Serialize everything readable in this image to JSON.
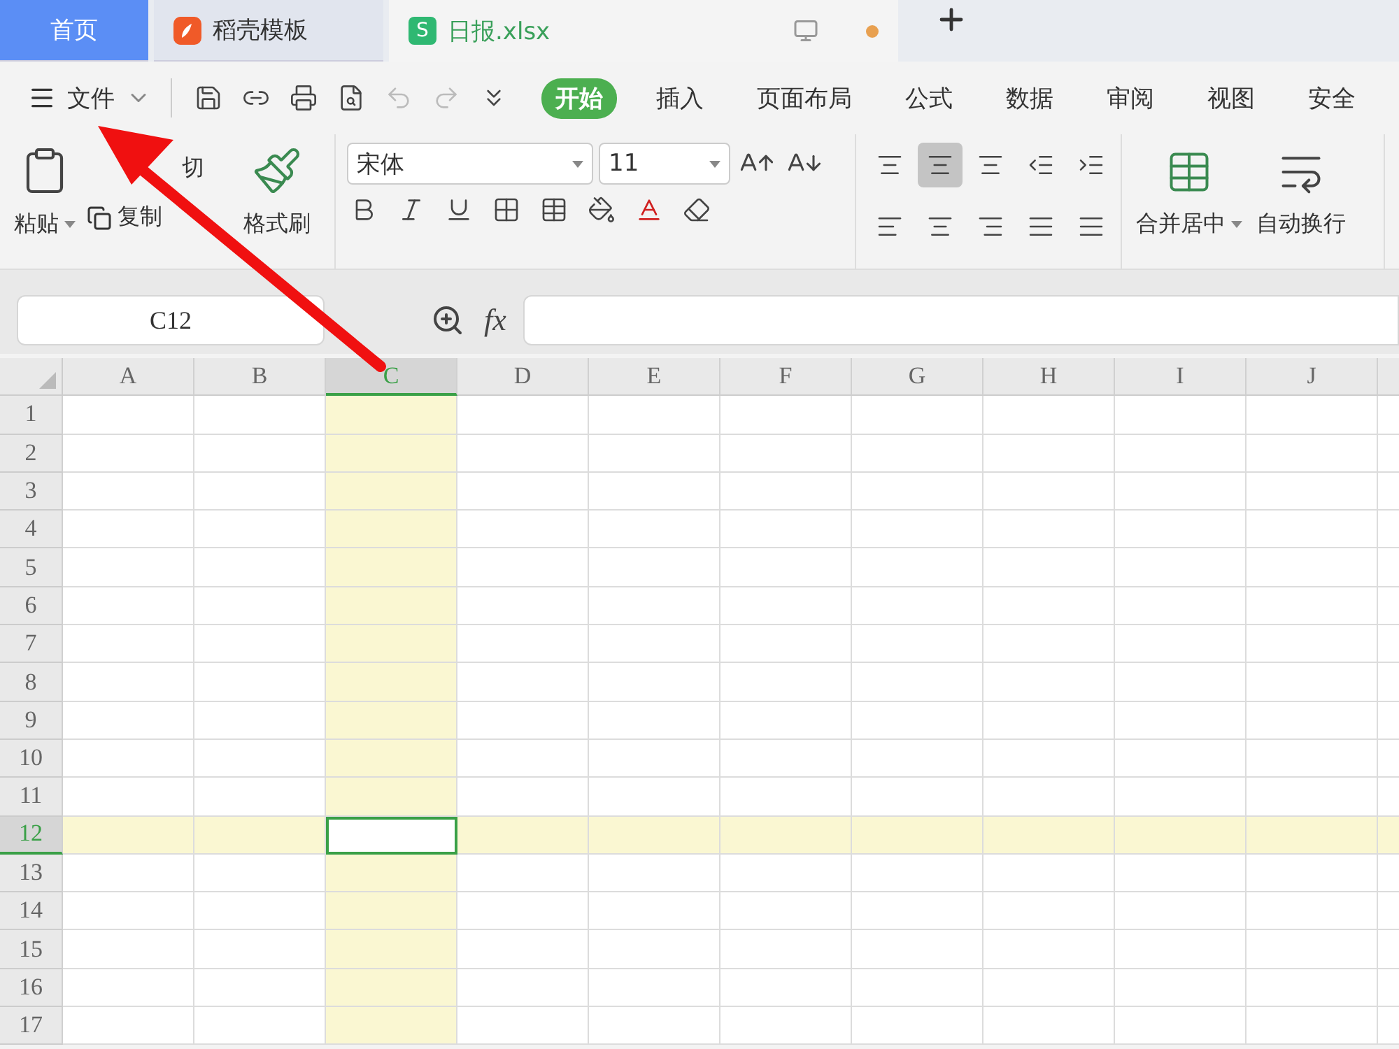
{
  "tabs": [
    {
      "label": "首页",
      "kind": "home",
      "selected": false
    },
    {
      "label": "稻壳模板",
      "kind": "template",
      "selected": false
    },
    {
      "label": "日报.xlsx",
      "kind": "sheet",
      "icon_text": "S",
      "selected": true
    }
  ],
  "file_menu": {
    "label": "文件"
  },
  "ribbon_tabs": [
    {
      "label": "开始",
      "selected": true
    },
    {
      "label": "插入",
      "selected": false
    },
    {
      "label": "页面布局",
      "selected": false
    },
    {
      "label": "公式",
      "selected": false
    },
    {
      "label": "数据",
      "selected": false
    },
    {
      "label": "审阅",
      "selected": false
    },
    {
      "label": "视图",
      "selected": false
    },
    {
      "label": "安全",
      "selected": false
    }
  ],
  "clipboard": {
    "paste": "粘贴",
    "cut": "切",
    "copy": "复制",
    "format_painter": "格式刷"
  },
  "font": {
    "name": "宋体",
    "size": "11"
  },
  "align_tools": [
    {
      "kind": "top",
      "selected": false
    },
    {
      "kind": "middle",
      "selected": true
    },
    {
      "kind": "bottom",
      "selected": false
    },
    {
      "kind": "outdent",
      "selected": false
    },
    {
      "kind": "indent",
      "selected": false
    },
    {
      "kind": "left",
      "selected": false
    },
    {
      "kind": "center",
      "selected": false
    },
    {
      "kind": "right",
      "selected": false
    },
    {
      "kind": "justify",
      "selected": false
    },
    {
      "kind": "distributed",
      "selected": false
    }
  ],
  "merge": {
    "label": "合并居中"
  },
  "wrap": {
    "label": "自动换行"
  },
  "formula_bar": {
    "name_box": "C12",
    "fx": "fx"
  },
  "grid": {
    "columns": [
      {
        "label": "A",
        "selected": false
      },
      {
        "label": "B",
        "selected": false
      },
      {
        "label": "C",
        "selected": true
      },
      {
        "label": "D",
        "selected": false
      },
      {
        "label": "E",
        "selected": false
      },
      {
        "label": "F",
        "selected": false
      },
      {
        "label": "G",
        "selected": false
      },
      {
        "label": "H",
        "selected": false
      },
      {
        "label": "I",
        "selected": false
      },
      {
        "label": "J",
        "selected": false
      }
    ],
    "rows": [
      {
        "label": "1",
        "selected": false
      },
      {
        "label": "2",
        "selected": false
      },
      {
        "label": "3",
        "selected": false
      },
      {
        "label": "4",
        "selected": false
      },
      {
        "label": "5",
        "selected": false
      },
      {
        "label": "6",
        "selected": false
      },
      {
        "label": "7",
        "selected": false
      },
      {
        "label": "8",
        "selected": false
      },
      {
        "label": "9",
        "selected": false
      },
      {
        "label": "10",
        "selected": false
      },
      {
        "label": "11",
        "selected": false
      },
      {
        "label": "12",
        "selected": true
      },
      {
        "label": "13",
        "selected": false
      },
      {
        "label": "14",
        "selected": false
      },
      {
        "label": "15",
        "selected": false
      },
      {
        "label": "16",
        "selected": false
      },
      {
        "label": "17",
        "selected": false
      }
    ]
  }
}
